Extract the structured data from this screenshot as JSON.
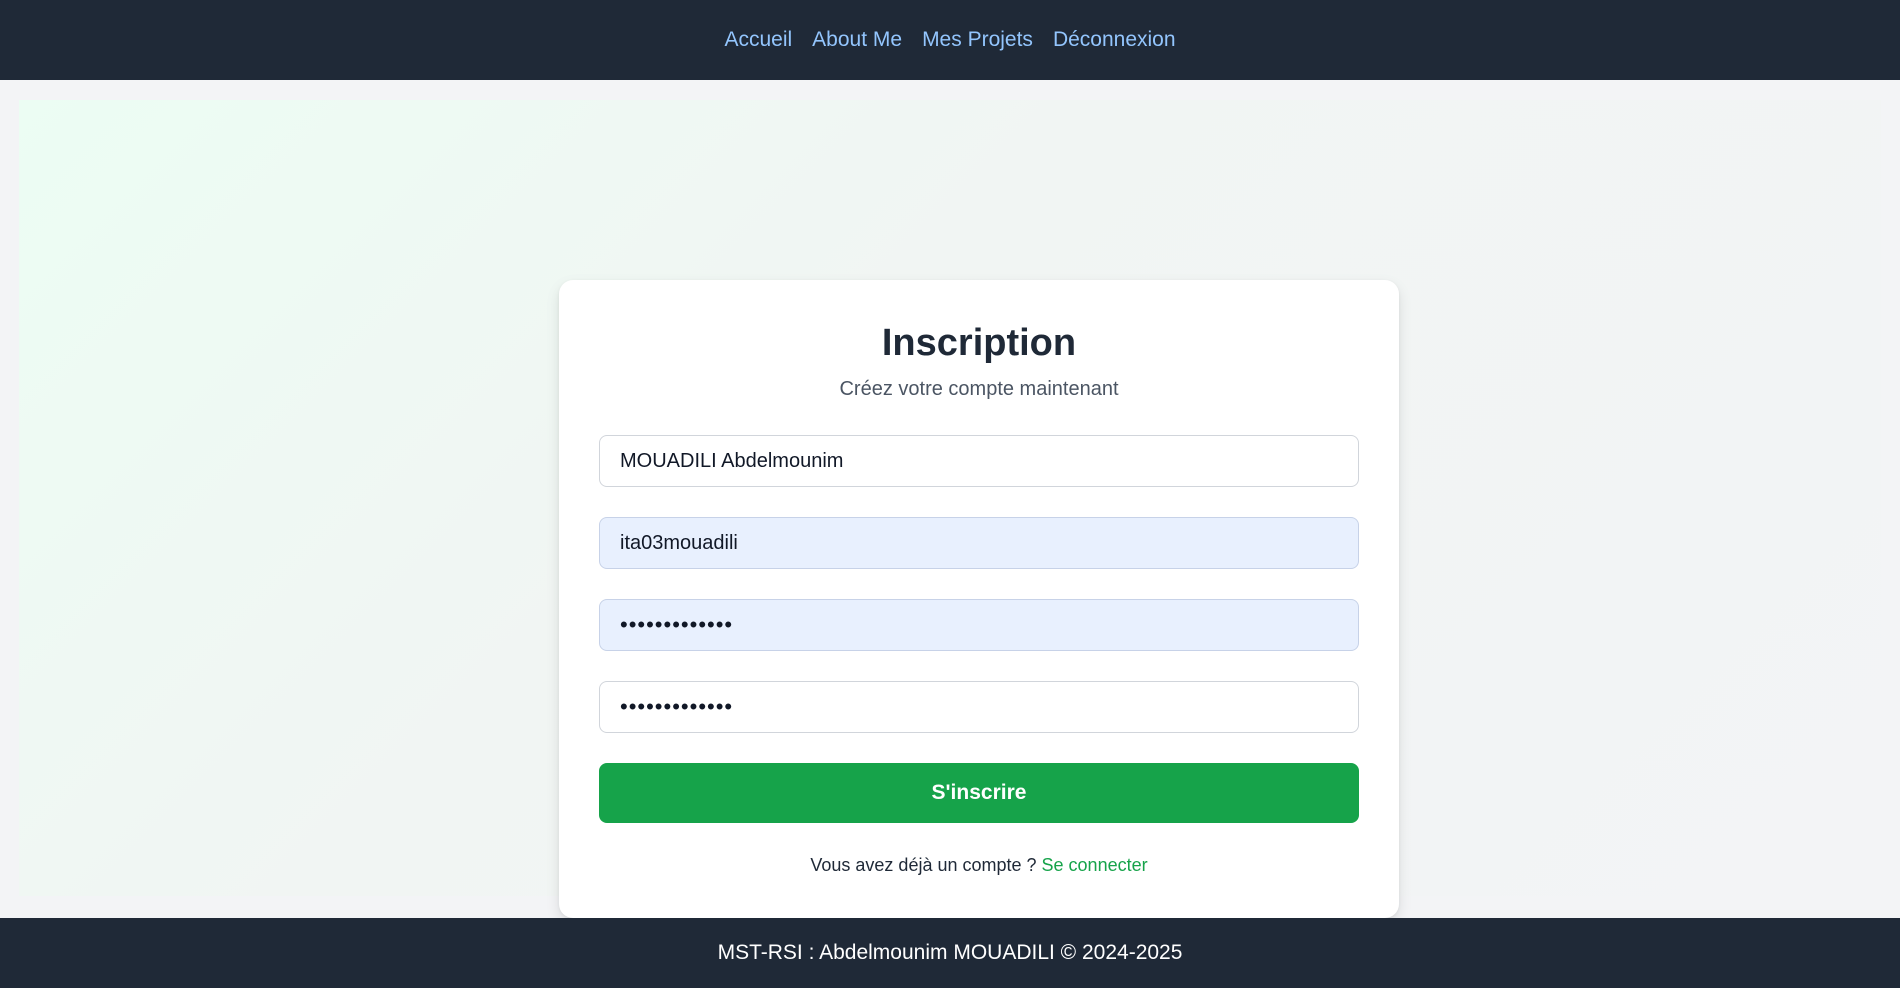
{
  "nav": {
    "items": [
      {
        "label": "Accueil"
      },
      {
        "label": "About Me"
      },
      {
        "label": "Mes Projets"
      },
      {
        "label": "Déconnexion"
      }
    ]
  },
  "form": {
    "title": "Inscription",
    "subtitle": "Créez votre compte maintenant",
    "fields": {
      "fullname": {
        "value": "MOUADILI Abdelmounim"
      },
      "username": {
        "value": "ita03mouadili"
      },
      "password": {
        "value": "•••••••••••••"
      },
      "confirm_password": {
        "value": "•••••••••••••"
      }
    },
    "submit_label": "S'inscrire",
    "login_prompt": "Vous avez déjà un compte ?",
    "login_link": "Se connecter"
  },
  "footer": {
    "text": "MST-RSI : Abdelmounim MOUADILI © 2024-2025"
  },
  "colors": {
    "nav_bg": "#1f2937",
    "nav_link": "#93c5fd",
    "accent_green": "#16a34a",
    "autofill_bg": "#e8f0fe"
  }
}
